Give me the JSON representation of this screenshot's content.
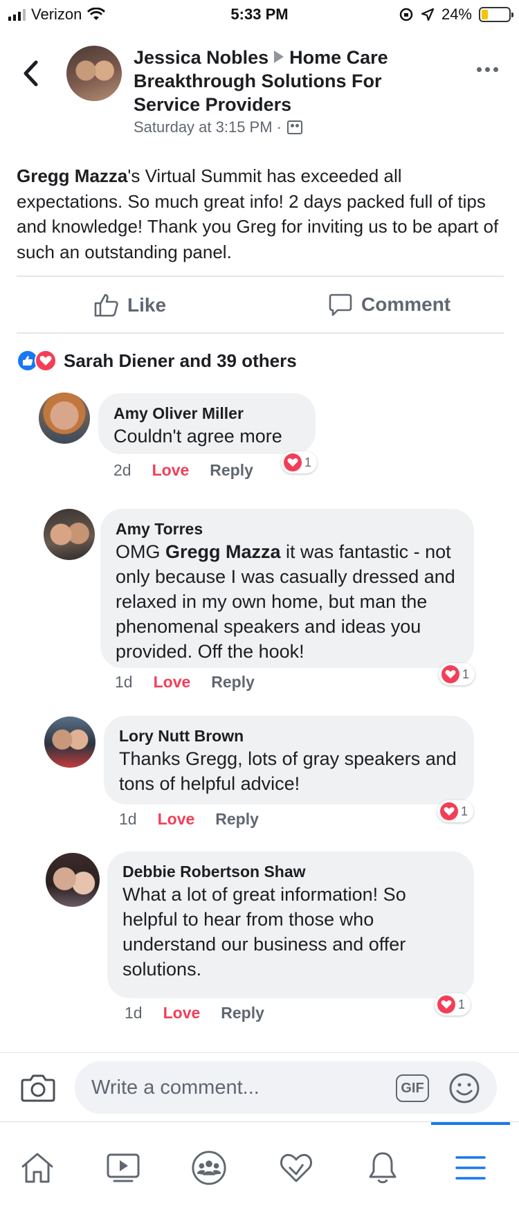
{
  "status_bar": {
    "carrier": "Verizon",
    "time": "5:33 PM",
    "battery": "24%",
    "battery_level": 0.24
  },
  "post": {
    "author": "Jessica Nobles",
    "group": "Home Care Breakthrough Solutions For Service Providers",
    "timestamp": "Saturday at 3:15 PM ·",
    "body_mention": "Gregg Mazza",
    "body_rest": "'s Virtual Summit has exceeded all expectations. So much great info! 2 days packed full of tips and knowledge! Thank you Greg for inviting us to be apart of such an outstanding panel.",
    "actions": {
      "like": "Like",
      "comment": "Comment"
    },
    "reactions_summary": "Sarah Diener and 39 others"
  },
  "comments": [
    {
      "author": "Amy Oliver Miller",
      "text": "Couldn't agree more",
      "time": "2d",
      "love": "Love",
      "reply": "Reply",
      "reaction_count": "1"
    },
    {
      "author": "Amy Torres",
      "text_prefix": "OMG ",
      "mention": "Gregg Mazza",
      "text": " it was fantastic - not only because I was casually dressed and relaxed in my own home, but man the phenomenal speakers and ideas you provided.  Off the hook!",
      "time": "1d",
      "love": "Love",
      "reply": "Reply",
      "reaction_count": "1"
    },
    {
      "author": "Lory Nutt Brown",
      "text": "Thanks Gregg, lots of gray speakers and tons of helpful advice!",
      "time": "1d",
      "love": "Love",
      "reply": "Reply",
      "reaction_count": "1"
    },
    {
      "author": "Debbie Robertson Shaw",
      "text": "What a lot of great information! So helpful to hear from those who understand our business and offer solutions.",
      "time": "1d",
      "love": "Love",
      "reply": "Reply",
      "reaction_count": "1"
    }
  ],
  "composer": {
    "placeholder": "Write a comment...",
    "gif_label": "GIF"
  },
  "icons": {
    "back": "chevron-left-icon",
    "more": "ellipsis-icon",
    "camera": "camera-icon",
    "emoji": "smiley-icon",
    "nav": [
      "home-icon",
      "watch-icon",
      "groups-icon",
      "dating-heart-icon",
      "bell-icon",
      "menu-icon"
    ]
  },
  "colors": {
    "facebook_blue": "#1877f2",
    "love_red": "#f33e58",
    "bubble_gray": "#eff1f3",
    "secondary_text": "#606770"
  }
}
